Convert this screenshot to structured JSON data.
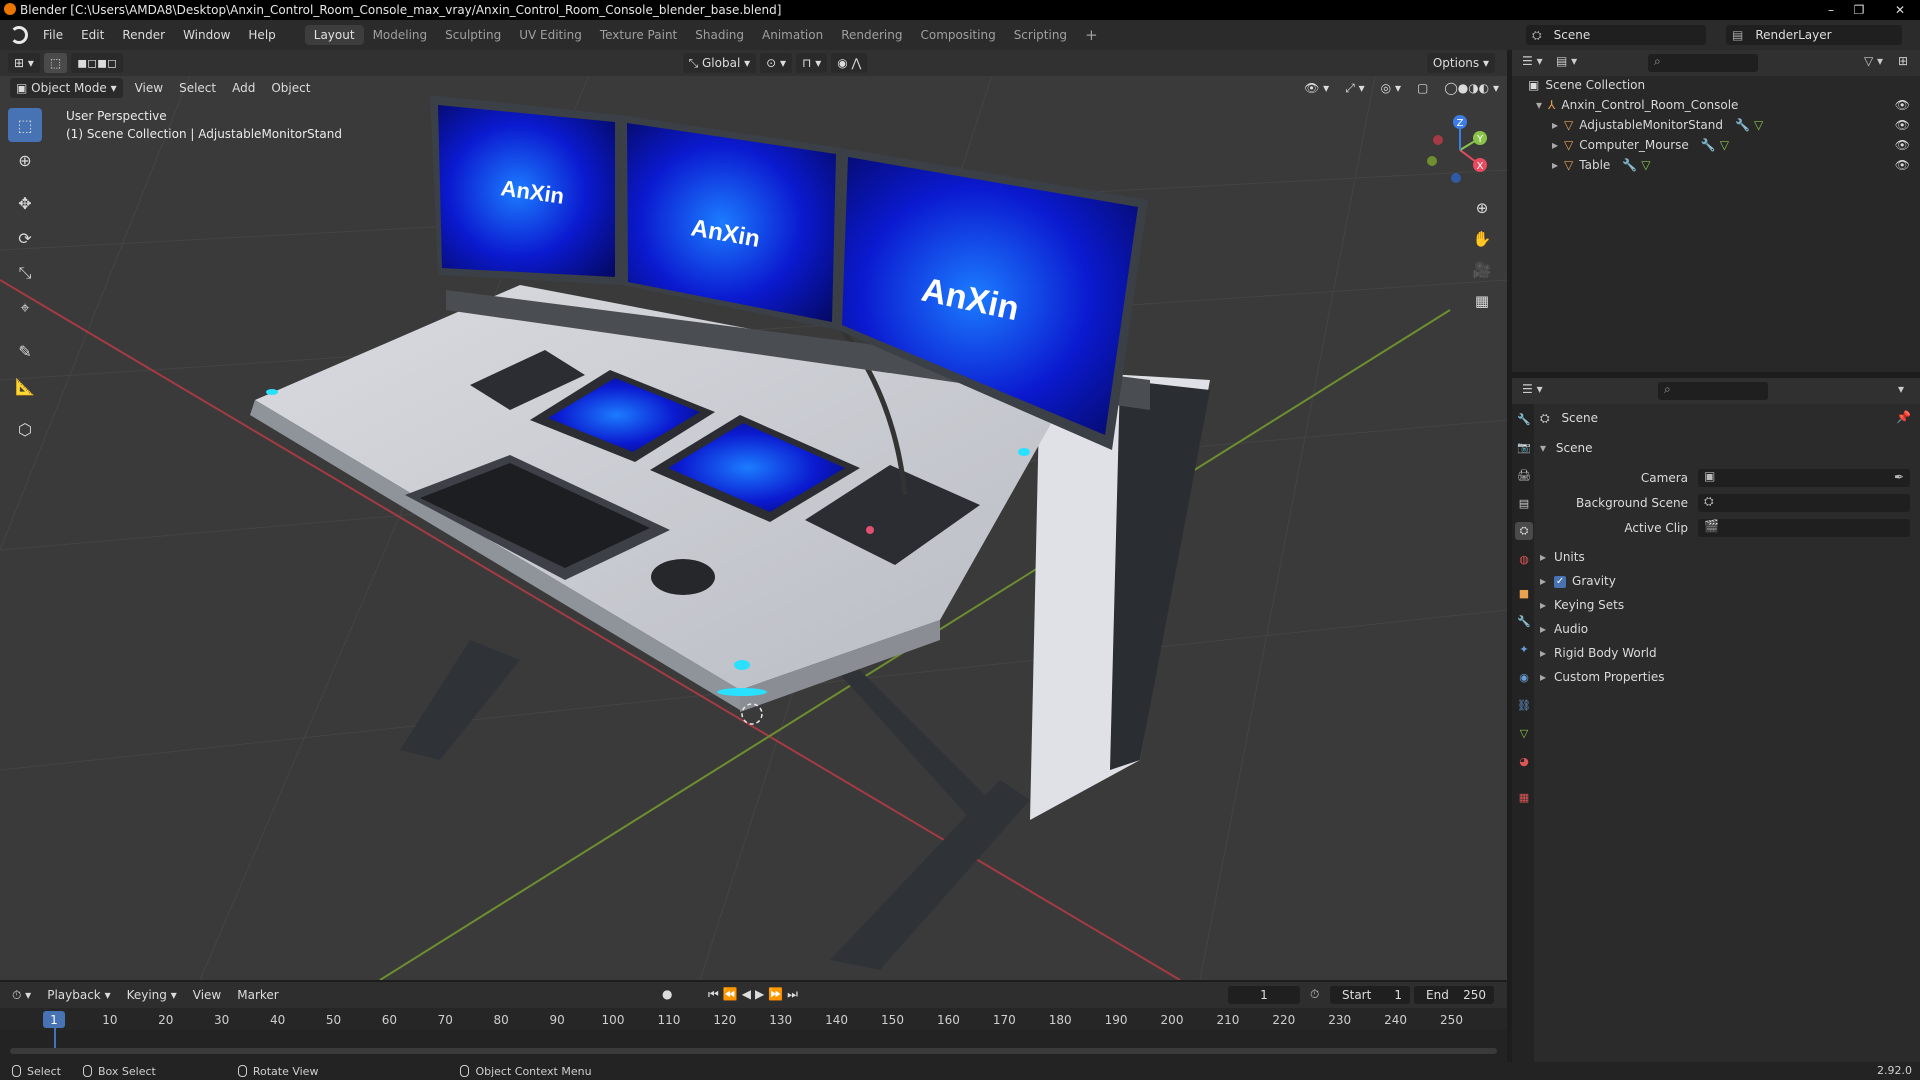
{
  "title": "Blender [C:\\Users\\AMDA8\\Desktop\\Anxin_Control_Room_Console_max_vray/Anxin_Control_Room_Console_blender_base.blend]",
  "menus": [
    "File",
    "Edit",
    "Render",
    "Window",
    "Help"
  ],
  "workspaces": [
    "Layout",
    "Modeling",
    "Sculpting",
    "UV Editing",
    "Texture Paint",
    "Shading",
    "Animation",
    "Rendering",
    "Compositing",
    "Scripting"
  ],
  "active_workspace": "Layout",
  "scene_selector": "Scene",
  "viewlayer_selector": "RenderLayer",
  "viewport": {
    "mode": "Object Mode",
    "menus": [
      "View",
      "Select",
      "Add",
      "Object"
    ],
    "orientation": "Global",
    "options": "Options",
    "info_line1": "User Perspective",
    "info_line2": "(1) Scene Collection | AdjustableMonitorStand",
    "screen_text": "AnXin",
    "gizmo_axes": [
      "X",
      "Y",
      "Z"
    ]
  },
  "outliner": {
    "root": "Scene Collection",
    "collection": "Anxin_Control_Room_Console",
    "objects": [
      "AdjustableMonitorStand",
      "Computer_Mourse",
      "Table"
    ]
  },
  "properties": {
    "header": "Scene",
    "panel": "Scene",
    "fields": [
      {
        "label": "Camera"
      },
      {
        "label": "Background Scene"
      },
      {
        "label": "Active Clip"
      }
    ],
    "sections": [
      "Units",
      "Gravity",
      "Keying Sets",
      "Audio",
      "Rigid Body World",
      "Custom Properties"
    ],
    "gravity_checked": true
  },
  "timeline": {
    "menus": [
      "Playback",
      "Keying",
      "View",
      "Marker"
    ],
    "current_frame": "1",
    "start_label": "Start",
    "start": "1",
    "end_label": "End",
    "end": "250",
    "ticks": [
      "1",
      "10",
      "20",
      "30",
      "40",
      "50",
      "60",
      "70",
      "80",
      "90",
      "100",
      "110",
      "120",
      "130",
      "140",
      "150",
      "160",
      "170",
      "180",
      "190",
      "200",
      "210",
      "220",
      "230",
      "240",
      "250"
    ]
  },
  "statusbar": {
    "items": [
      "Select",
      "Box Select",
      "Rotate View",
      "Object Context Menu"
    ],
    "version": "2.92.0"
  },
  "colors": {
    "accent": "#4772b3",
    "x_axis": "#e84a5f",
    "y_axis": "#8bc34a",
    "z_axis": "#3d7de6",
    "glow": "#29e0ff"
  }
}
